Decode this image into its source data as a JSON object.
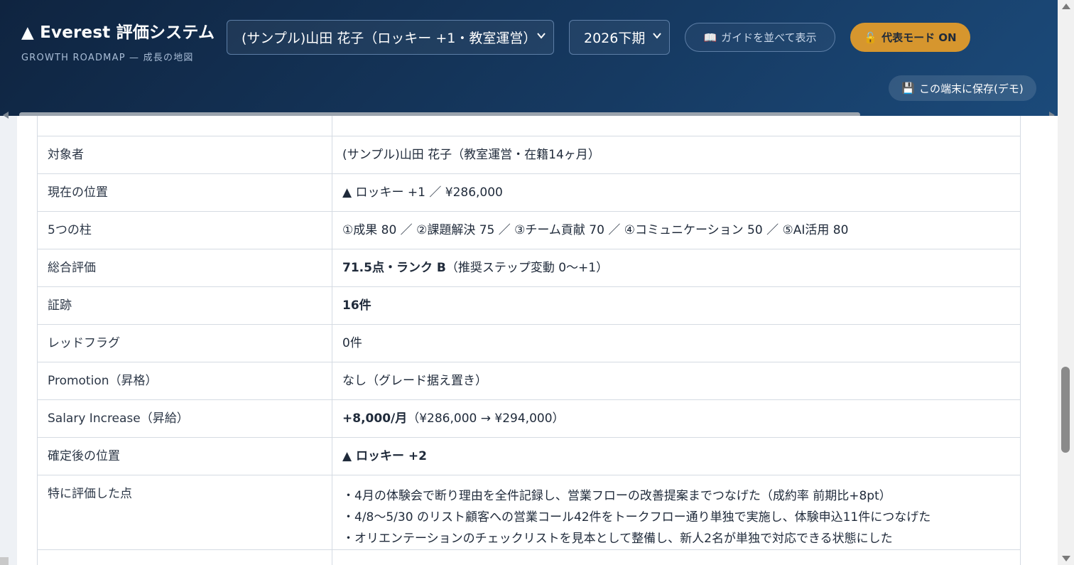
{
  "header": {
    "brand_title": "▲ Everest 評価システム",
    "brand_subtitle": "GROWTH ROADMAP — 成長の地図",
    "person_select": "(サンプル)山田 花子（ロッキー +1・教室運営）",
    "period_select": "2026下期",
    "guide_button": "ガイドを並べて表示",
    "guide_icon": "📖",
    "owner_mode_button": "代表モード ON",
    "owner_icon": "🔓",
    "save_button": "この端末に保存(デモ)",
    "save_icon": "💾"
  },
  "summary": {
    "rows": [
      {
        "label": "対象者",
        "value": "(サンプル)山田 花子（教室運営・在籍14ヶ月）"
      },
      {
        "label": "現在の位置",
        "value": "▲ ロッキー +1 ／ ¥286,000"
      },
      {
        "label": "5つの柱",
        "value": "①成果 80 ／ ②課題解決 75 ／ ③チーム貢献 70 ／ ④コミュニケーション 50 ／ ⑤AI活用 80"
      },
      {
        "label": "総合評価",
        "value_bold": "71.5点・ランク B",
        "value_rest": "（推奨ステップ変動 0〜+1）"
      },
      {
        "label": "証跡",
        "value_bold": "16件"
      },
      {
        "label": "レッドフラグ",
        "value": "0件"
      },
      {
        "label": "Promotion（昇格）",
        "value": "なし（グレード据え置き）"
      },
      {
        "label": "Salary Increase（昇給）",
        "value_bold": "+8,000/月",
        "value_rest": "（¥286,000 → ¥294,000）"
      },
      {
        "label": "確定後の位置",
        "value_bold": "▲ ロッキー +2"
      }
    ],
    "highlights_label": "特に評価した点",
    "highlights": [
      "・4月の体験会で断り理由を全件記録し、営業フローの改善提案までつなげた（成約率 前期比+8pt）",
      "・4/8〜5/30 のリスト顧客への営業コール42件をトークフロー通り単独で実施し、体験申込11件につなげた",
      "・オリエンテーションのチェックリストを見本として整備し、新人2名が単独で対応できる状態にした"
    ]
  },
  "colors": {
    "header_bg": "#163a62",
    "accent_gold": "#d6962e",
    "border": "#d5dbe3"
  }
}
